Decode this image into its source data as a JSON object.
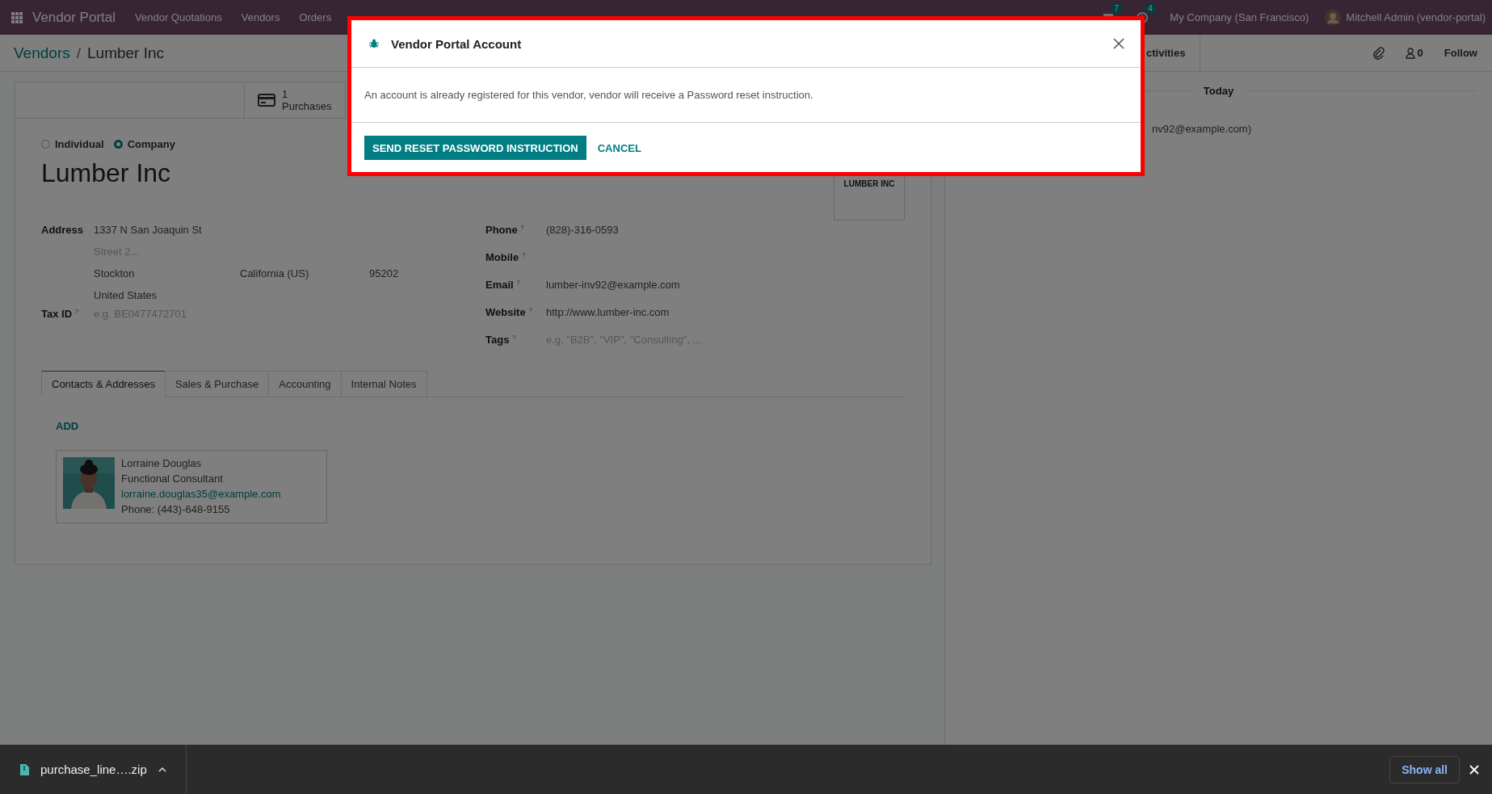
{
  "navbar": {
    "app_name": "Vendor Portal",
    "menu": [
      "Vendor Quotations",
      "Vendors",
      "Orders"
    ],
    "systray": [
      {
        "kind": "chat",
        "badge": "7"
      },
      {
        "kind": "activity",
        "badge": "4"
      }
    ],
    "company": "My Company (San Francisco)",
    "user": "Mitchell Admin (vendor-portal)"
  },
  "breadcrumb": [
    {
      "label": "Vendors",
      "link": true
    },
    {
      "label": "Lumber Inc",
      "link": false
    }
  ],
  "breadcrumb_separator": "/",
  "stat_buttons": [
    {
      "count": "1",
      "label": "Purchases"
    }
  ],
  "company_type": [
    {
      "label": "Individual",
      "selected": false
    },
    {
      "label": "Company",
      "selected": true
    }
  ],
  "name": "Lumber Inc",
  "logo_text": "LUMBER INC",
  "address": {
    "label": "Address",
    "street": "1337 N San Joaquin St",
    "street2_placeholder": "Street 2...",
    "city": "Stockton",
    "state": "California (US)",
    "zip": "95202",
    "country": "United States"
  },
  "tax_id": {
    "label": "Tax ID",
    "help": "?",
    "placeholder": "e.g. BE0477472701"
  },
  "right_fields": [
    {
      "label": "Phone",
      "help": "?",
      "value": "(828)-316-0593"
    },
    {
      "label": "Mobile",
      "help": "?"
    },
    {
      "label": "Email",
      "help": "?",
      "value": "lumber-inv92@example.com"
    },
    {
      "label": "Website",
      "help": "?",
      "value": "http://www.lumber-inc.com"
    },
    {
      "label": "Tags",
      "help": "?",
      "placeholder": "e.g. \"B2B\", \"VIP\", \"Consulting\", ..."
    }
  ],
  "tabs": [
    {
      "label": "Contacts & Addresses",
      "selected": true
    },
    {
      "label": "Sales & Purchase",
      "selected": false
    },
    {
      "label": "Accounting",
      "selected": false
    },
    {
      "label": "Internal Notes",
      "selected": false
    }
  ],
  "add_button": "ADD",
  "contacts": [
    {
      "name": "Lorraine Douglas",
      "function": "Functional Consultant",
      "email": "lorraine.douglas35@example.com",
      "phone": "Phone: (443)-648-9155"
    }
  ],
  "chatter": {
    "activities_button": "ctivities",
    "followers": "0",
    "follow": "Follow",
    "date": "Today",
    "message": "nv92@example.com)"
  },
  "modal": {
    "title": "Vendor Portal Account",
    "body": "An account is already registered for this vendor, vendor will receive a Password reset instruction.",
    "primary": "SEND RESET PASSWORD INSTRUCTION",
    "secondary": "CANCEL"
  },
  "download": {
    "file": "purchase_line….zip",
    "show_all": "Show all"
  }
}
